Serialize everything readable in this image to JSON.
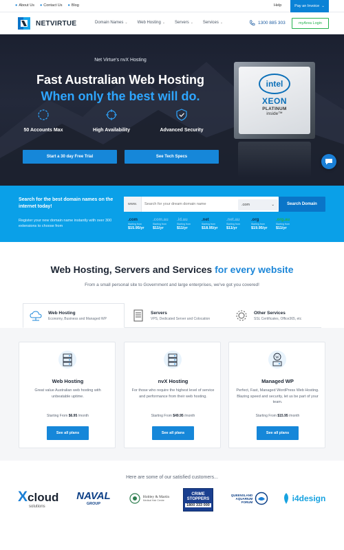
{
  "topbar": {
    "links": [
      "About Us",
      "Contact Us",
      "Blog"
    ],
    "help": "Help",
    "pay_invoice": "Pay an Invoice"
  },
  "nav": {
    "logo_text": "NETVIRTUE",
    "menu": [
      "Domain Names",
      "Web Hosting",
      "Servers",
      "Services"
    ],
    "phone": "1300 885 303",
    "login": "myArea Login"
  },
  "hero": {
    "tagline": "Net Virtue's nvX Hosting",
    "headline": "Fast Australian Web Hosting",
    "subheadline": "When only the best will do.",
    "features": [
      "50 Accounts Max",
      "High Availability",
      "Advanced Security"
    ],
    "trial_button": "Start a 30 day Free Trial",
    "specs_button": "See Tech Specs",
    "chip": {
      "brand": "intel",
      "line": "XEON",
      "tier": "PLATINUM",
      "inside": "inside™"
    }
  },
  "domain": {
    "title": "Search for the best domain names on the internet today!",
    "description": "Register your new domain name instantly with over 300 extensions to choose from",
    "prefix": "www.",
    "placeholder": "Search for your dream domain name",
    "selected_tld": ".com",
    "search_button": "Search Domain",
    "tlds": [
      {
        "name": ".com",
        "sub": "Starting from",
        "price": "$15.95/yr",
        "color": "#0d2c4a"
      },
      {
        "name": ".com.au",
        "sub": "Starting from",
        "price": "$11/yr",
        "color": "#7cc6f2"
      },
      {
        "name": ".id.au",
        "sub": "Starting from",
        "price": "$11/yr",
        "color": "#7cc6f2"
      },
      {
        "name": ".net",
        "sub": "Starting from",
        "price": "$18.95/yr",
        "color": "#0d2c4a"
      },
      {
        "name": ".net.au",
        "sub": "Starting from",
        "price": "$11/yr",
        "color": "#7cc6f2"
      },
      {
        "name": ".org",
        "sub": "Starting from",
        "price": "$19.95/yr",
        "color": "#0d2c4a"
      },
      {
        "name": ".org.au",
        "sub": "Starting from",
        "price": "$11/yr",
        "color": "#22b14c"
      }
    ]
  },
  "hosting": {
    "title_main": "Web Hosting, Servers and Services ",
    "title_accent": "for every website",
    "subtitle": "From a small personal site to Government and large enterprises, we've got you covered!",
    "tabs": [
      {
        "title": "Web Hosting",
        "desc": "Economy, Business and Managed WP"
      },
      {
        "title": "Servers",
        "desc": "VPS, Dedicated Server and Colocation"
      },
      {
        "title": "Other Services",
        "desc": "SSL Certificates, Office365, etc"
      }
    ],
    "cards": [
      {
        "title": "Web Hosting",
        "desc": "Great value Australian web hosting with unbeatable uptime.",
        "starting": "Starting From ",
        "price": "$6.95",
        "per": " /month",
        "button": "See all plans"
      },
      {
        "title": "nvX Hosting",
        "desc": "For those who require the highest level of service and performance from their web hosting.",
        "starting": "Starting From ",
        "price": "$49.95",
        "per": " /month",
        "button": "See all plans"
      },
      {
        "title": "Managed WP",
        "desc": "Perfect, Fast, Managed WordPress Web Hosting. Blazing speed and security, let us be part of your team.",
        "starting": "Starting From ",
        "price": "$15.95",
        "per": " /month",
        "button": "See all plans"
      }
    ]
  },
  "customers": {
    "heading": "Here are some of our satisfied customers...",
    "logos": {
      "xcloud": {
        "main": "cloud",
        "x": "X",
        "sub": "solutions"
      },
      "naval": {
        "main": "NAVAL",
        "sub": "GROUP"
      },
      "hobley": {
        "main": "Hobley & Martin",
        "sub": "Medical Hair Centre"
      },
      "crime": {
        "line1": "CRIME",
        "line2": "STOPPERS",
        "phone": "1800 333 000"
      },
      "aquarium": {
        "line1": "QUEENSLAND",
        "line2": "AQUARIUM",
        "line3": "FORUM"
      },
      "i4": {
        "main": "i4design"
      }
    }
  }
}
